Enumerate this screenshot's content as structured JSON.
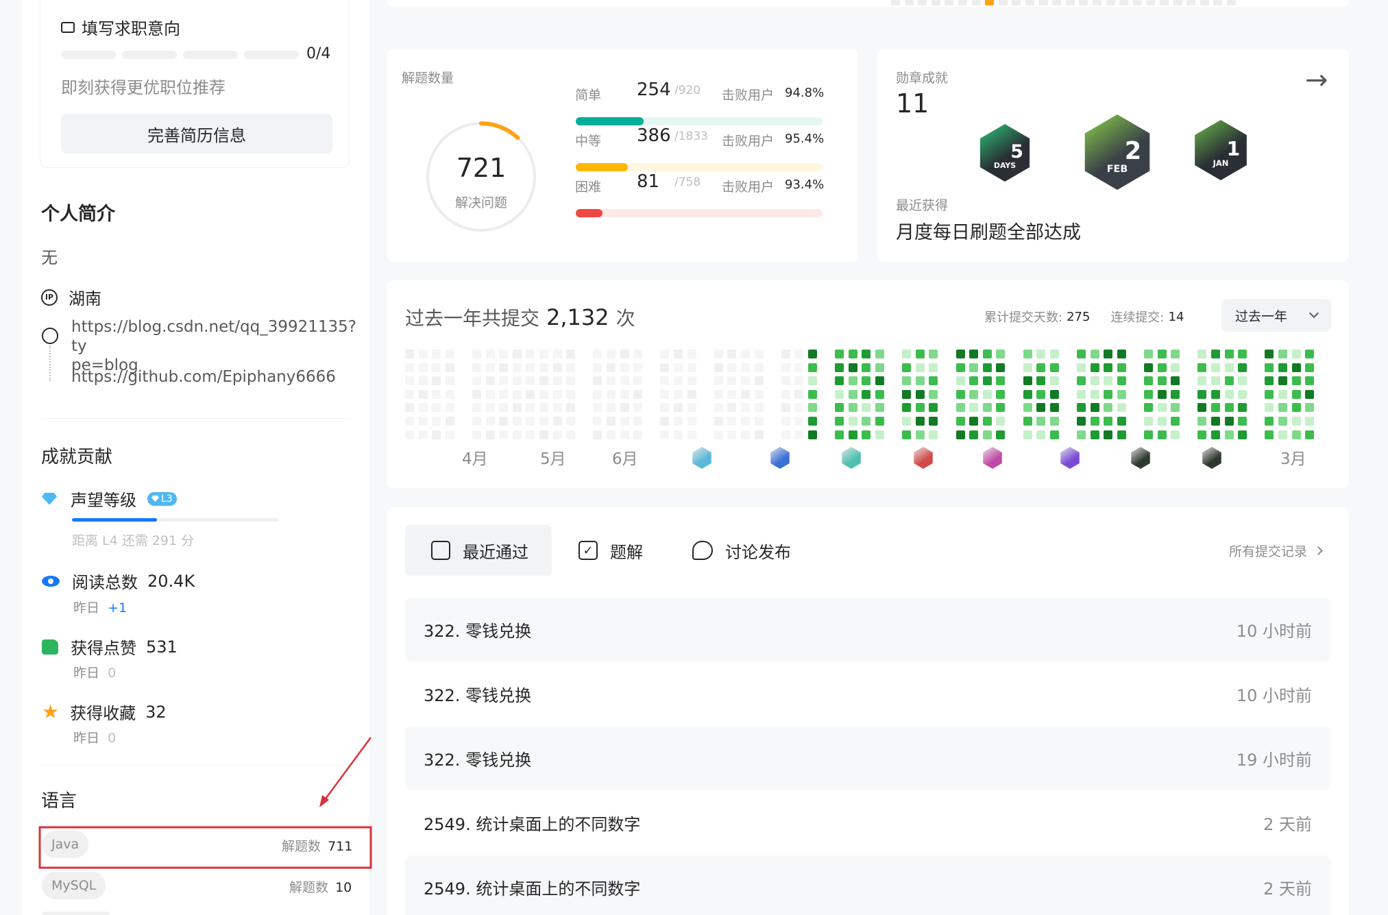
{
  "job_intent": {
    "title": "填写求职意向",
    "progress_text": "0/4",
    "subtitle": "即刻获得更优职位推荐",
    "button": "完善简历信息"
  },
  "profile": {
    "bio_heading": "个人简介",
    "bio": "无",
    "location": "湖南",
    "link1_line1": "https://blog.csdn.net/qq_39921135?ty",
    "link1_line2": "pe=blog",
    "link2": "https://github.com/Epiphany6666"
  },
  "achievements": {
    "heading": "成就贡献",
    "reputation_label": "声望等级",
    "reputation_badge": "L3",
    "reputation_progress": 0.41,
    "reputation_hint": "距离 L4 还需 291 分",
    "reads_label": "阅读总数",
    "reads_value": "20.4K",
    "reads_yesterday_label": "昨日",
    "reads_yesterday_value": "+1",
    "likes_label": "获得点赞",
    "likes_value": "531",
    "likes_yesterday_label": "昨日",
    "likes_yesterday_value": "0",
    "favs_label": "获得收藏",
    "favs_value": "32",
    "favs_yesterday_label": "昨日",
    "favs_yesterday_value": "0"
  },
  "languages": {
    "heading": "语言",
    "items": [
      {
        "name": "Java",
        "label": "解题数",
        "count": "711"
      },
      {
        "name": "MySQL",
        "label": "解题数",
        "count": "10"
      }
    ]
  },
  "solved": {
    "title": "解题数量",
    "total": "721",
    "total_label": "解决问题",
    "ring_fraction": 0.12,
    "levels": [
      {
        "name": "简单",
        "count": "254",
        "total": "/920",
        "beat_label": "击败用户",
        "beat": "94.8%",
        "fill": 0.276,
        "color": "#00af9b",
        "track": "#e6f7f3"
      },
      {
        "name": "中等",
        "count": "386",
        "total": "/1833",
        "beat_label": "击败用户",
        "beat": "95.4%",
        "fill": 0.21,
        "color": "#ffb800",
        "track": "#fff7e0"
      },
      {
        "name": "困难",
        "count": "81",
        "total": "/758",
        "beat_label": "击败用户",
        "beat": "93.4%",
        "fill": 0.107,
        "color": "#ef4743",
        "track": "#fde9e8"
      }
    ]
  },
  "badges": {
    "title": "勋章成就",
    "count": "11",
    "recent_label": "最近获得",
    "recent_name": "月度每日刷题全部达成",
    "items": [
      {
        "top": "5",
        "bottom": "DAYS"
      },
      {
        "top": "2",
        "bottom": "FEB"
      },
      {
        "top": "1",
        "bottom": "JAN"
      }
    ]
  },
  "heatmap": {
    "title_prefix": "过去一年共提交",
    "total": "2,132",
    "title_suffix": "次",
    "days_label": "累计提交天数:",
    "days_value": "275",
    "streak_label": "连续提交:",
    "streak_value": "14",
    "range_select": "过去一年",
    "month_labels": [
      "4月",
      "5月",
      "6月",
      "3月"
    ]
  },
  "tabs": {
    "recent": "最近通过",
    "solutions": "题解",
    "discuss": "讨论发布",
    "all_link": "所有提交记录"
  },
  "submissions": [
    {
      "title": "322. 零钱兑换",
      "time": "10 小时前"
    },
    {
      "title": "322. 零钱兑换",
      "time": "10 小时前"
    },
    {
      "title": "322. 零钱兑换",
      "time": "19 小时前"
    },
    {
      "title": "2549. 统计桌面上的不同数字",
      "time": "2 天前"
    },
    {
      "title": "2549. 统计桌面上的不同数字",
      "time": "2 天前"
    }
  ]
}
